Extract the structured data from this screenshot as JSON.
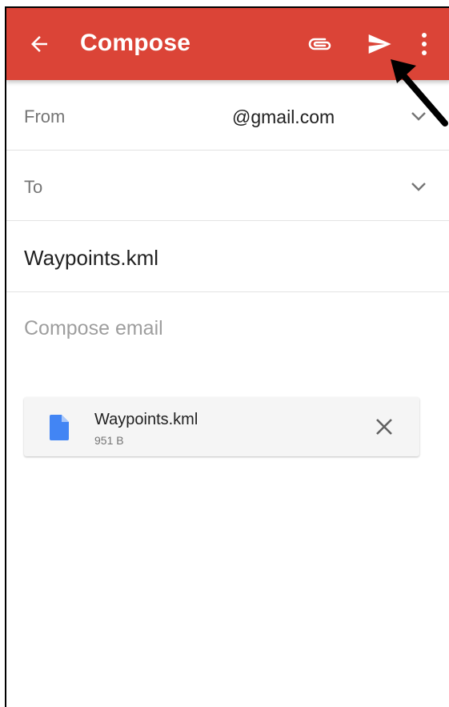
{
  "appbar": {
    "title": "Compose",
    "icons": [
      "back-arrow-icon",
      "paperclip-icon",
      "send-icon",
      "more-vert-icon"
    ],
    "color": "#db4437"
  },
  "fields": {
    "from_label": "From",
    "from_value": "@gmail.com",
    "to_label": "To",
    "subject": "Waypoints.kml",
    "body_placeholder": "Compose email"
  },
  "attachment": {
    "name": "Waypoints.kml",
    "size": "951 B",
    "icon": "file-icon",
    "icon_color": "#4285f4"
  },
  "annotation": {
    "icon": "pointer-arrow-icon"
  }
}
